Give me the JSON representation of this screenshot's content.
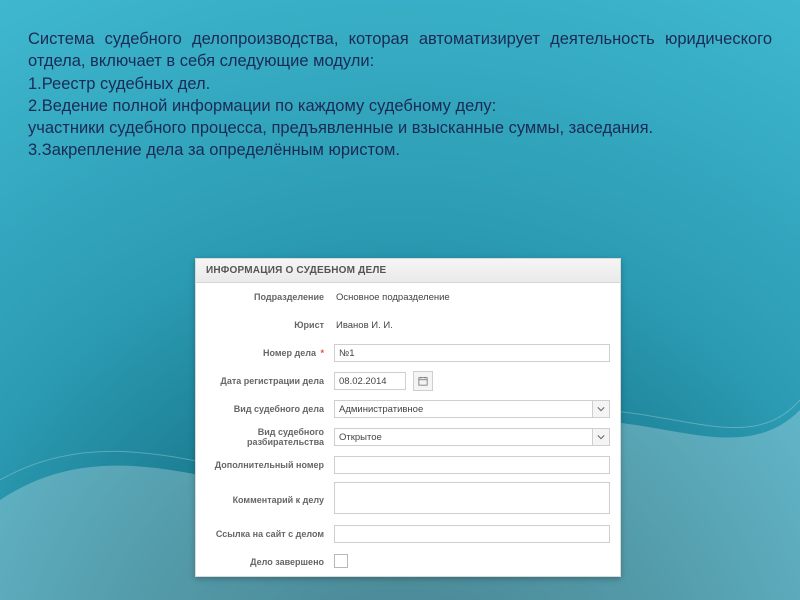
{
  "text": {
    "intro": "Система судебного делопроизводства, которая автоматизирует деятельность юридического отдела,  включает в себя следующие модули:",
    "line1": "1.Реестр судебных дел.",
    "line2": "2.Ведение полной информации по каждому судебному делу:",
    "line3": "участники судебного процесса, предъявленные и взысканные суммы, заседания.",
    "line4": "3.Закрепление дела за определённым юристом."
  },
  "form": {
    "header": "ИНФОРМАЦИЯ О СУДЕБНОМ ДЕЛЕ",
    "labels": {
      "subdivision": "Подразделение",
      "lawyer": "Юрист",
      "case_number": "Номер дела",
      "reg_date": "Дата регистрации дела",
      "case_type": "Вид судебного дела",
      "proceeding_type": "Вид судебного разбирательства",
      "extra_number": "Дополнительный номер",
      "comment": "Комментарий к делу",
      "link": "Ссылка на сайт с делом",
      "closed": "Дело завершено"
    },
    "values": {
      "subdivision": "Основное подразделение",
      "lawyer": "Иванов И. И.",
      "case_number": "№1",
      "reg_date": "08.02.2014",
      "case_type": "Административное",
      "proceeding_type": "Открытое",
      "extra_number": "",
      "comment": "",
      "link": "",
      "closed": false
    },
    "required_mark": "*"
  }
}
